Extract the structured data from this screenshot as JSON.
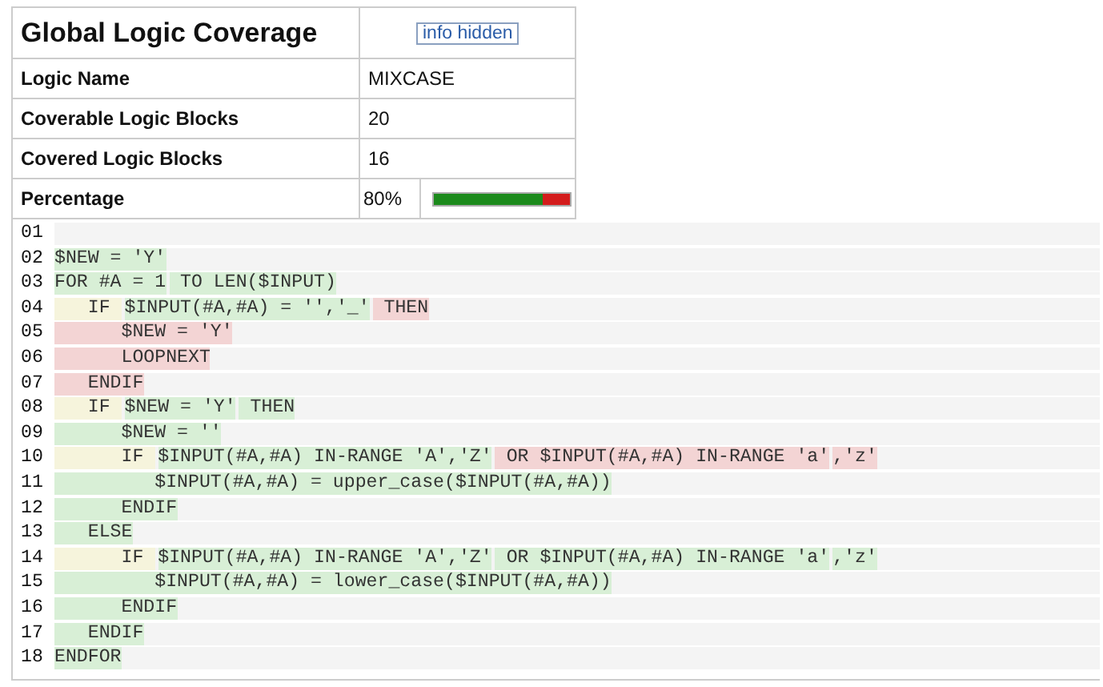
{
  "summary": {
    "title": "Global Logic Coverage",
    "info_button": "info hidden",
    "rows": [
      {
        "label": "Logic Name",
        "value": "MIXCASE"
      },
      {
        "label": "Coverable Logic Blocks",
        "value": "20"
      },
      {
        "label": "Covered Logic Blocks",
        "value": "16"
      }
    ],
    "percentage": {
      "label": "Percentage",
      "reading": "80%",
      "level": 0.8
    }
  },
  "code": [
    {
      "number": "01"
    },
    {
      "number": "02",
      "segments": [
        {
          "text": "$NEW = 'Y'",
          "color": "#d8efd6"
        }
      ]
    },
    {
      "number": "03",
      "segments": [
        {
          "text": "FOR #A = 1",
          "color": "#d8efd6"
        },
        {
          "text": " TO LEN($INPUT)",
          "color": "#d8efd6"
        }
      ]
    },
    {
      "number": "04",
      "segments": [
        {
          "text": "   IF ",
          "color": "#f6f4dc"
        },
        {
          "text": "$INPUT(#A,#A) = '','_'",
          "color": "#d8efd6"
        },
        {
          "text": " THEN",
          "color": "#f3d4d4"
        }
      ]
    },
    {
      "number": "05",
      "segments": [
        {
          "text": "      $NEW = 'Y'",
          "color": "#f3d4d4"
        }
      ]
    },
    {
      "number": "06",
      "segments": [
        {
          "text": "      LOOPNEXT",
          "color": "#f3d4d4"
        }
      ]
    },
    {
      "number": "07",
      "segments": [
        {
          "text": "   ENDIF",
          "color": "#f3d4d4"
        }
      ]
    },
    {
      "number": "08",
      "segments": [
        {
          "text": "   IF ",
          "color": "#f6f4dc"
        },
        {
          "text": "$NEW = 'Y'",
          "color": "#d8efd6"
        },
        {
          "text": " THEN",
          "color": "#d8efd6"
        }
      ]
    },
    {
      "number": "09",
      "segments": [
        {
          "text": "      $NEW = ''",
          "color": "#d8efd6"
        }
      ]
    },
    {
      "number": "10",
      "segments": [
        {
          "text": "      IF ",
          "color": "#f6f4dc"
        },
        {
          "text": "$INPUT(#A,#A) IN-RANGE 'A','Z'",
          "color": "#d8efd6"
        },
        {
          "text": " OR $INPUT(#A,#A) IN-RANGE 'a'",
          "color": "#f3d4d4"
        },
        {
          "text": ",'z'",
          "color": "#f3d4d4"
        }
      ]
    },
    {
      "number": "11",
      "segments": [
        {
          "text": "         $INPUT(#A,#A) = upper_case($INPUT(#A,#A))",
          "color": "#d8efd6"
        }
      ]
    },
    {
      "number": "12",
      "segments": [
        {
          "text": "      ENDIF",
          "color": "#d8efd6"
        }
      ]
    },
    {
      "number": "13",
      "segments": [
        {
          "text": "   ELSE",
          "color": "#d8efd6"
        }
      ]
    },
    {
      "number": "14",
      "segments": [
        {
          "text": "      IF ",
          "color": "#f6f4dc"
        },
        {
          "text": "$INPUT(#A,#A) IN-RANGE 'A','Z'",
          "color": "#d8efd6"
        },
        {
          "text": " OR $INPUT(#A,#A) IN-RANGE 'a'",
          "color": "#d8efd6"
        },
        {
          "text": ",'z'",
          "color": "#d8efd6"
        }
      ]
    },
    {
      "number": "15",
      "segments": [
        {
          "text": "         $INPUT(#A,#A) = lower_case($INPUT(#A,#A))",
          "color": "#d8efd6"
        }
      ]
    },
    {
      "number": "16",
      "segments": [
        {
          "text": "      ENDIF",
          "color": "#d8efd6"
        }
      ]
    },
    {
      "number": "17",
      "segments": [
        {
          "text": "   ENDIF",
          "color": "#d8efd6"
        }
      ]
    },
    {
      "number": "18",
      "segments": [
        {
          "text": "ENDFOR",
          "color": "#d8efd6"
        }
      ]
    }
  ]
}
